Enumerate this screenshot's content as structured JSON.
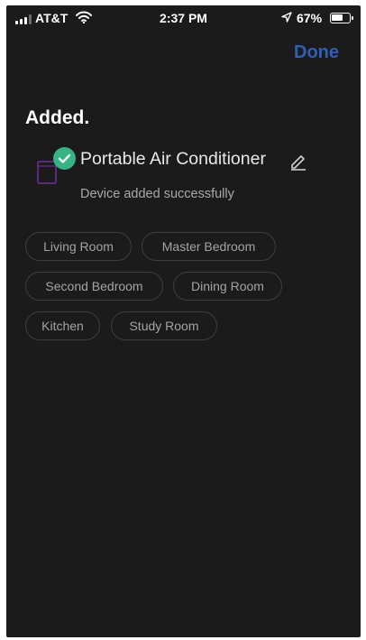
{
  "status_bar": {
    "carrier": "AT&T",
    "time": "2:37 PM",
    "battery_percent": "67%",
    "battery_level": 0.67,
    "icons": [
      "signal-icon",
      "wifi-icon",
      "location-arrow-icon",
      "battery-icon"
    ]
  },
  "header": {
    "done_label": "Done",
    "accent_color": "#2f5fb7"
  },
  "page": {
    "title": "Added."
  },
  "device": {
    "name": "Portable Air Conditioner",
    "status": "Device added successfully",
    "success_color": "#35b383",
    "device_icon": "air-conditioner-icon",
    "edit_icon": "pencil-icon"
  },
  "rooms": [
    {
      "label": "Living Room"
    },
    {
      "label": "Master Bedroom"
    },
    {
      "label": "Second Bedroom"
    },
    {
      "label": "Dining Room"
    },
    {
      "label": "Kitchen"
    },
    {
      "label": "Study Room"
    }
  ]
}
